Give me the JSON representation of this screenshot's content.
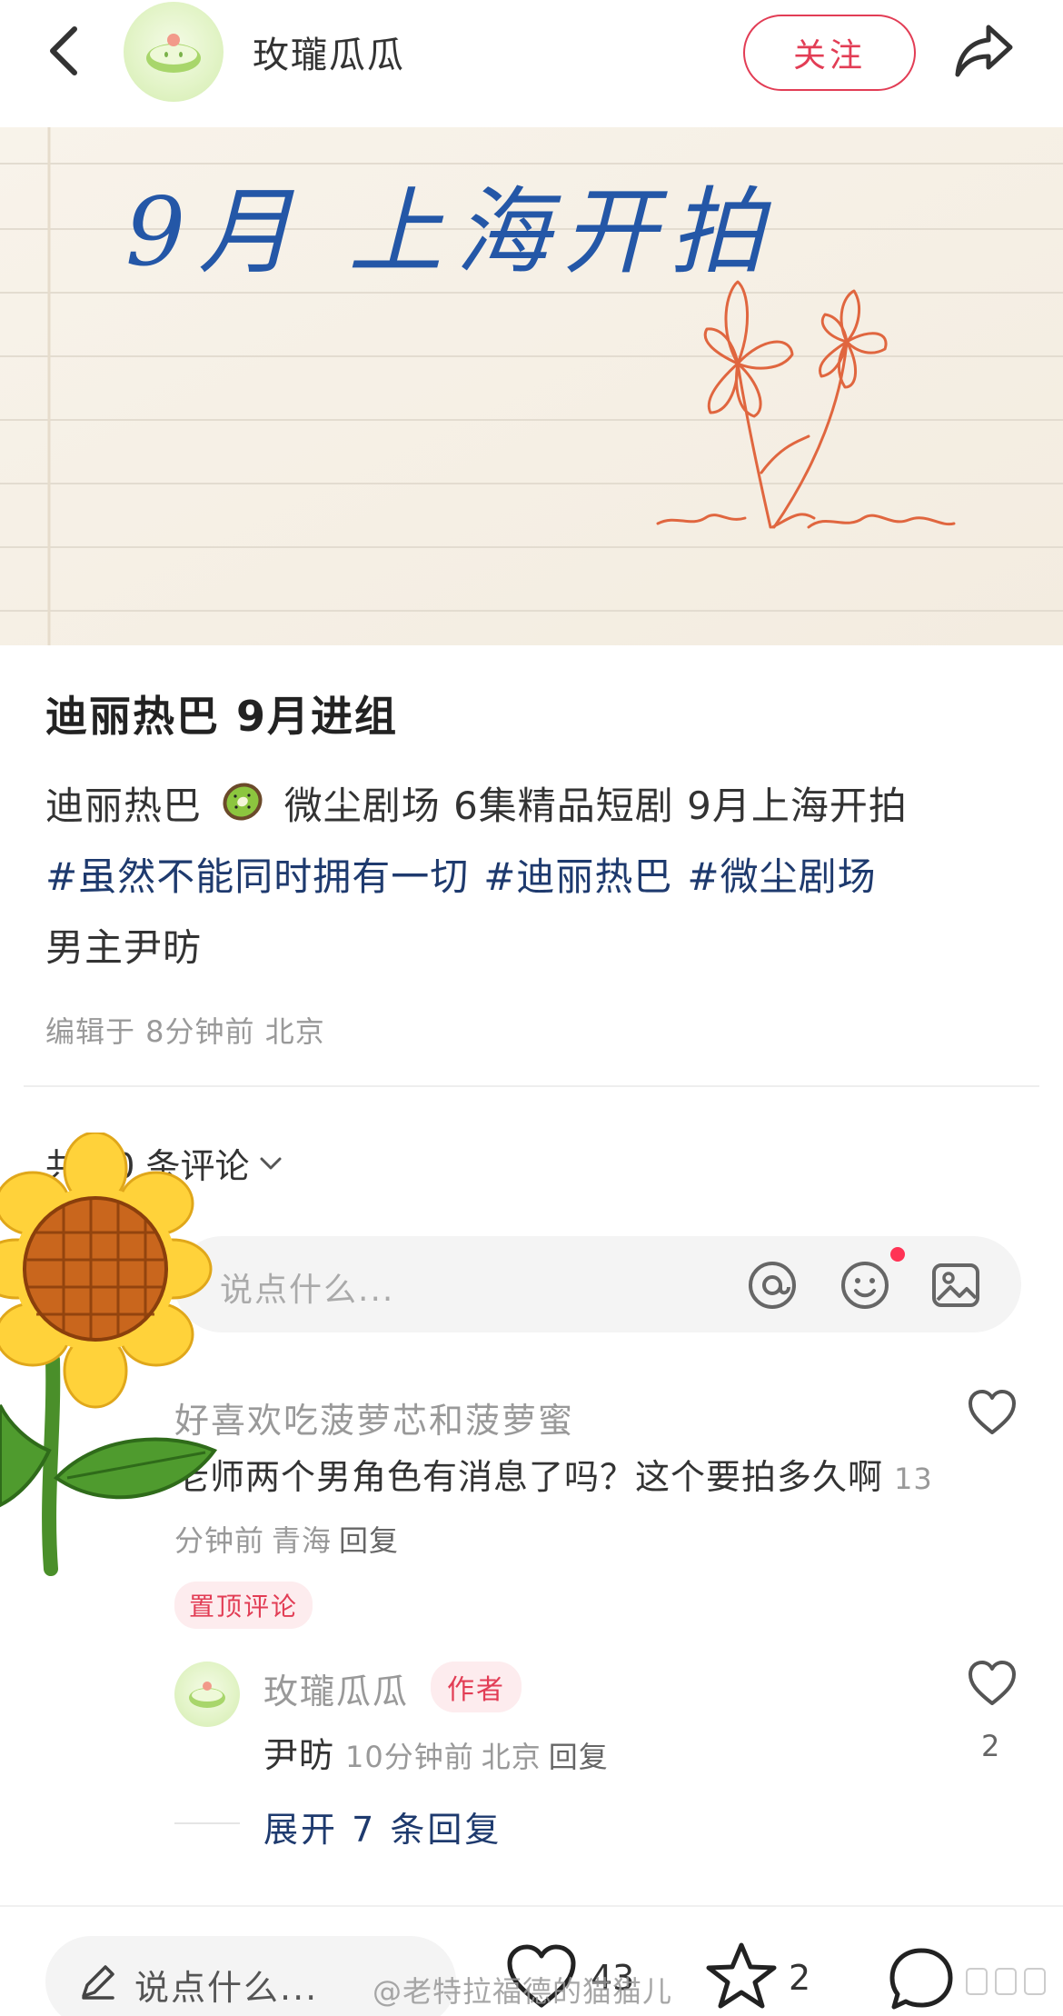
{
  "header": {
    "author_name": "玫瓏瓜瓜",
    "follow_label": "关注"
  },
  "cover": {
    "handwritten_text": "9月 上海开拍"
  },
  "post": {
    "title": "迪丽热巴 9月进组",
    "line1_prefix": "迪丽热巴",
    "line1_suffix": "微尘剧场 6集精品短剧 9月上海开拍",
    "hashtags": [
      "#虽然不能同时拥有一切",
      "#迪丽热巴",
      "#微尘剧场"
    ],
    "line3": "男主尹昉",
    "meta": "编辑于 8分钟前 北京"
  },
  "comments": {
    "count_label": "共 10 条评论",
    "input_placeholder": "说点什么...",
    "items": [
      {
        "username": "好喜欢吃菠萝芯和菠萝蜜",
        "text": "老师两个男角色有消息了吗？这个要拍多久啊",
        "time": "13分钟前",
        "location": "青海",
        "reply_label": "回复",
        "badge": "置顶评论"
      }
    ],
    "reply": {
      "username": "玫瓏瓜瓜",
      "badge": "作者",
      "text": "尹昉",
      "time": "10分钟前",
      "location": "北京",
      "reply_label": "回复",
      "like_count": "2"
    },
    "expand_label": "展开 7 条回复"
  },
  "bottom_bar": {
    "input_placeholder": "说点什么...",
    "like_count": "43",
    "star_count": "2",
    "watermark": "@老特拉福德的猫猫儿"
  },
  "colors": {
    "accent_red": "#e23d55",
    "hashtag_blue": "#1e3a6e"
  }
}
